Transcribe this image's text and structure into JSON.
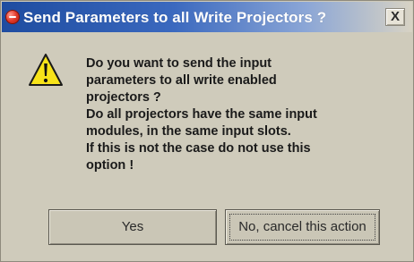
{
  "window": {
    "title": "Send Parameters to all Write Projectors ?",
    "close_glyph": "X",
    "title_icon": "error-circle-icon",
    "title_bar_color": "#1e4ca0"
  },
  "message": {
    "icon": "warning-icon",
    "lines": [
      "Do you want to send the input",
      "parameters to all write enabled",
      "projectors ?",
      "Do all projectors have the same input",
      "modules, in the same input slots.",
      "If this is not the case do not use this",
      "option !"
    ]
  },
  "buttons": {
    "yes_label": "Yes",
    "no_label": "No, cancel this action"
  }
}
